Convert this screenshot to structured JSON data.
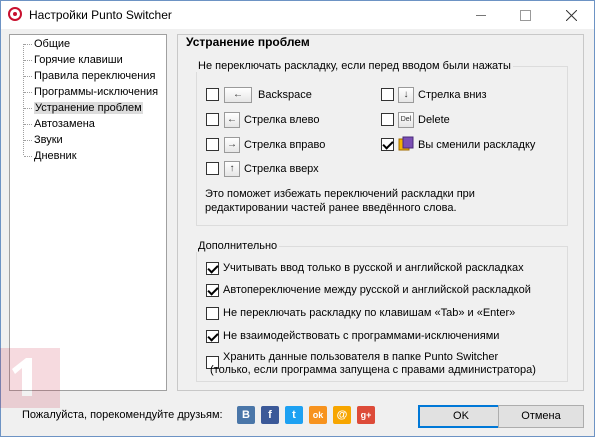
{
  "window": {
    "title": "Настройки Punto Switcher"
  },
  "tree": {
    "items": [
      {
        "label": "Общие"
      },
      {
        "label": "Горячие клавиши"
      },
      {
        "label": "Правила переключения"
      },
      {
        "label": "Программы-исключения"
      },
      {
        "label": "Устранение проблем",
        "selected": true
      },
      {
        "label": "Автозамена"
      },
      {
        "label": "Звуки"
      },
      {
        "label": "Дневник"
      }
    ]
  },
  "panel": {
    "title": "Устранение проблем",
    "group1": {
      "title": "Не переключать раскладку, если перед вводом были нажаты",
      "items": [
        {
          "label": "Backspace",
          "key": "←",
          "checked": false
        },
        {
          "label": "Стрелка вниз",
          "key": "↓",
          "checked": false
        },
        {
          "label": "Стрелка влево",
          "key": "←",
          "checked": false
        },
        {
          "label": "Delete",
          "key": "Del",
          "checked": false
        },
        {
          "label": "Стрелка вправо",
          "key": "→",
          "checked": false
        },
        {
          "label": "Вы сменили раскладку",
          "key": "",
          "checked": true
        },
        {
          "label": "Стрелка вверх",
          "key": "↑",
          "checked": false
        }
      ],
      "note": "Это поможет избежать переключений раскладки при редактировании частей ранее введённого слова."
    },
    "group2": {
      "title": "Дополнительно",
      "items": [
        {
          "label": "Учитывать ввод только в русской и английской раскладках",
          "checked": true
        },
        {
          "label": "Автопереключение между русской и английской раскладкой",
          "checked": true
        },
        {
          "label": "Не переключать раскладку по клавишам «Tab» и «Enter»",
          "checked": false
        },
        {
          "label": "Не взаимодействовать с программами-исключениями",
          "checked": true
        },
        {
          "label": "Хранить данные пользователя в папке Punto Switcher",
          "label2": "(только, если программа запущена с правами администратора)",
          "checked": false
        }
      ]
    }
  },
  "footer": {
    "recommend": "Пожалуйста, порекомендуйте друзьям:",
    "social": [
      {
        "name": "vk-icon",
        "glyph": "В",
        "color": "#4a76a8"
      },
      {
        "name": "facebook-icon",
        "glyph": "f",
        "color": "#3b5998"
      },
      {
        "name": "twitter-icon",
        "glyph": "t",
        "color": "#1da1f2"
      },
      {
        "name": "odnoklassniki-icon",
        "glyph": "ok",
        "color": "#f7931e"
      },
      {
        "name": "mail-icon",
        "glyph": "@",
        "color": "#f7a600"
      },
      {
        "name": "googleplus-icon",
        "glyph": "g+",
        "color": "#dd4b39"
      }
    ],
    "ok": "OK",
    "cancel": "Отмена"
  }
}
